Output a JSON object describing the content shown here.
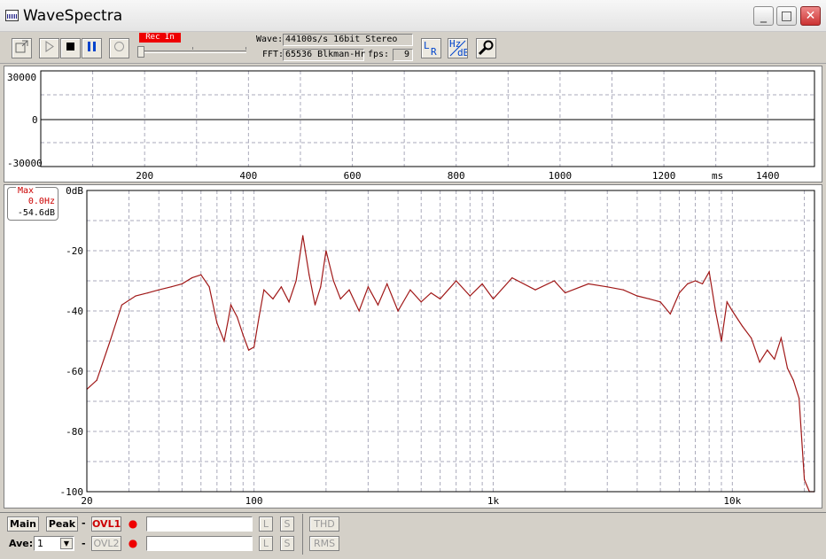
{
  "window": {
    "title": "WaveSpectra",
    "controls": [
      "_",
      "□",
      "✕"
    ]
  },
  "toolbar": {
    "rec_indicator": "Rec In",
    "wave_label": "Wave:",
    "wave_value": "44100s/s 16bit Stereo",
    "fft_label": "FFT:",
    "fft_value": "65536 Blkman-Hr",
    "fps_label": "fps:",
    "fps_value": "9",
    "buttons": [
      "open-wave",
      "play",
      "stop",
      "pause",
      "loop",
      "channel-lr",
      "hz-db",
      "settings"
    ]
  },
  "waveform": {
    "y_ticks": [
      "30000",
      "0",
      "-30000"
    ],
    "x_ticks": [
      "200",
      "400",
      "600",
      "800",
      "1000",
      "1200",
      "1400"
    ],
    "x_unit": "ms"
  },
  "spectrum": {
    "y_ticks": [
      "0dB",
      "-20",
      "-40",
      "-60",
      "-80",
      "-100"
    ],
    "x_ticks": [
      "20",
      "100",
      "1k",
      "10k"
    ],
    "max_box": {
      "title": "Max",
      "freq": "0.0Hz",
      "level": "-54.6dB"
    }
  },
  "chart_data": {
    "type": "line",
    "x_scale": "log",
    "xlabel": "",
    "ylabel": "",
    "xlim": [
      20,
      22050
    ],
    "ylim": [
      -100,
      0
    ],
    "grid": true,
    "series": [
      {
        "color": "#a01818",
        "x": [
          20,
          22,
          25,
          28,
          32,
          36,
          40,
          45,
          50,
          55,
          60,
          65,
          70,
          75,
          78,
          80,
          85,
          90,
          95,
          100,
          105,
          110,
          120,
          130,
          140,
          150,
          160,
          170,
          180,
          190,
          200,
          215,
          230,
          250,
          275,
          300,
          330,
          360,
          400,
          450,
          500,
          550,
          600,
          700,
          800,
          900,
          1000,
          1200,
          1500,
          1800,
          2000,
          2500,
          3000,
          3500,
          4000,
          4500,
          5000,
          5500,
          6000,
          6500,
          7000,
          7500,
          8000,
          8500,
          9000,
          9500,
          10000,
          11000,
          12000,
          13000,
          14000,
          15000,
          16000,
          17000,
          18000,
          19000,
          20000,
          21000,
          22000
        ],
        "y": [
          -66,
          -63,
          -50,
          -38,
          -35,
          -34,
          -33,
          -32,
          -31,
          -29,
          -28,
          -32,
          -44,
          -50,
          -43,
          -38,
          -42,
          -48,
          -53,
          -52,
          -42,
          -33,
          -36,
          -32,
          -37,
          -30,
          -15,
          -28,
          -38,
          -32,
          -20,
          -30,
          -36,
          -33,
          -40,
          -32,
          -38,
          -31,
          -40,
          -33,
          -37,
          -34,
          -36,
          -30,
          -35,
          -31,
          -36,
          -29,
          -33,
          -30,
          -34,
          -31,
          -32,
          -33,
          -35,
          -36,
          -37,
          -41,
          -34,
          -31,
          -30,
          -31,
          -27,
          -40,
          -50,
          -37,
          -40,
          -45,
          -49,
          -57,
          -53,
          -56,
          -49,
          -59,
          -63,
          -69,
          -96,
          -100,
          -100
        ]
      }
    ]
  },
  "statusbar": {
    "main": "Main",
    "peak": "Peak",
    "dash": "-",
    "ovl1": "OVL1",
    "ovl2": "OVL2",
    "ave_label": "Ave:",
    "ave_value": "1",
    "l": "L",
    "s": "S",
    "thd": "THD",
    "rms": "RMS"
  }
}
